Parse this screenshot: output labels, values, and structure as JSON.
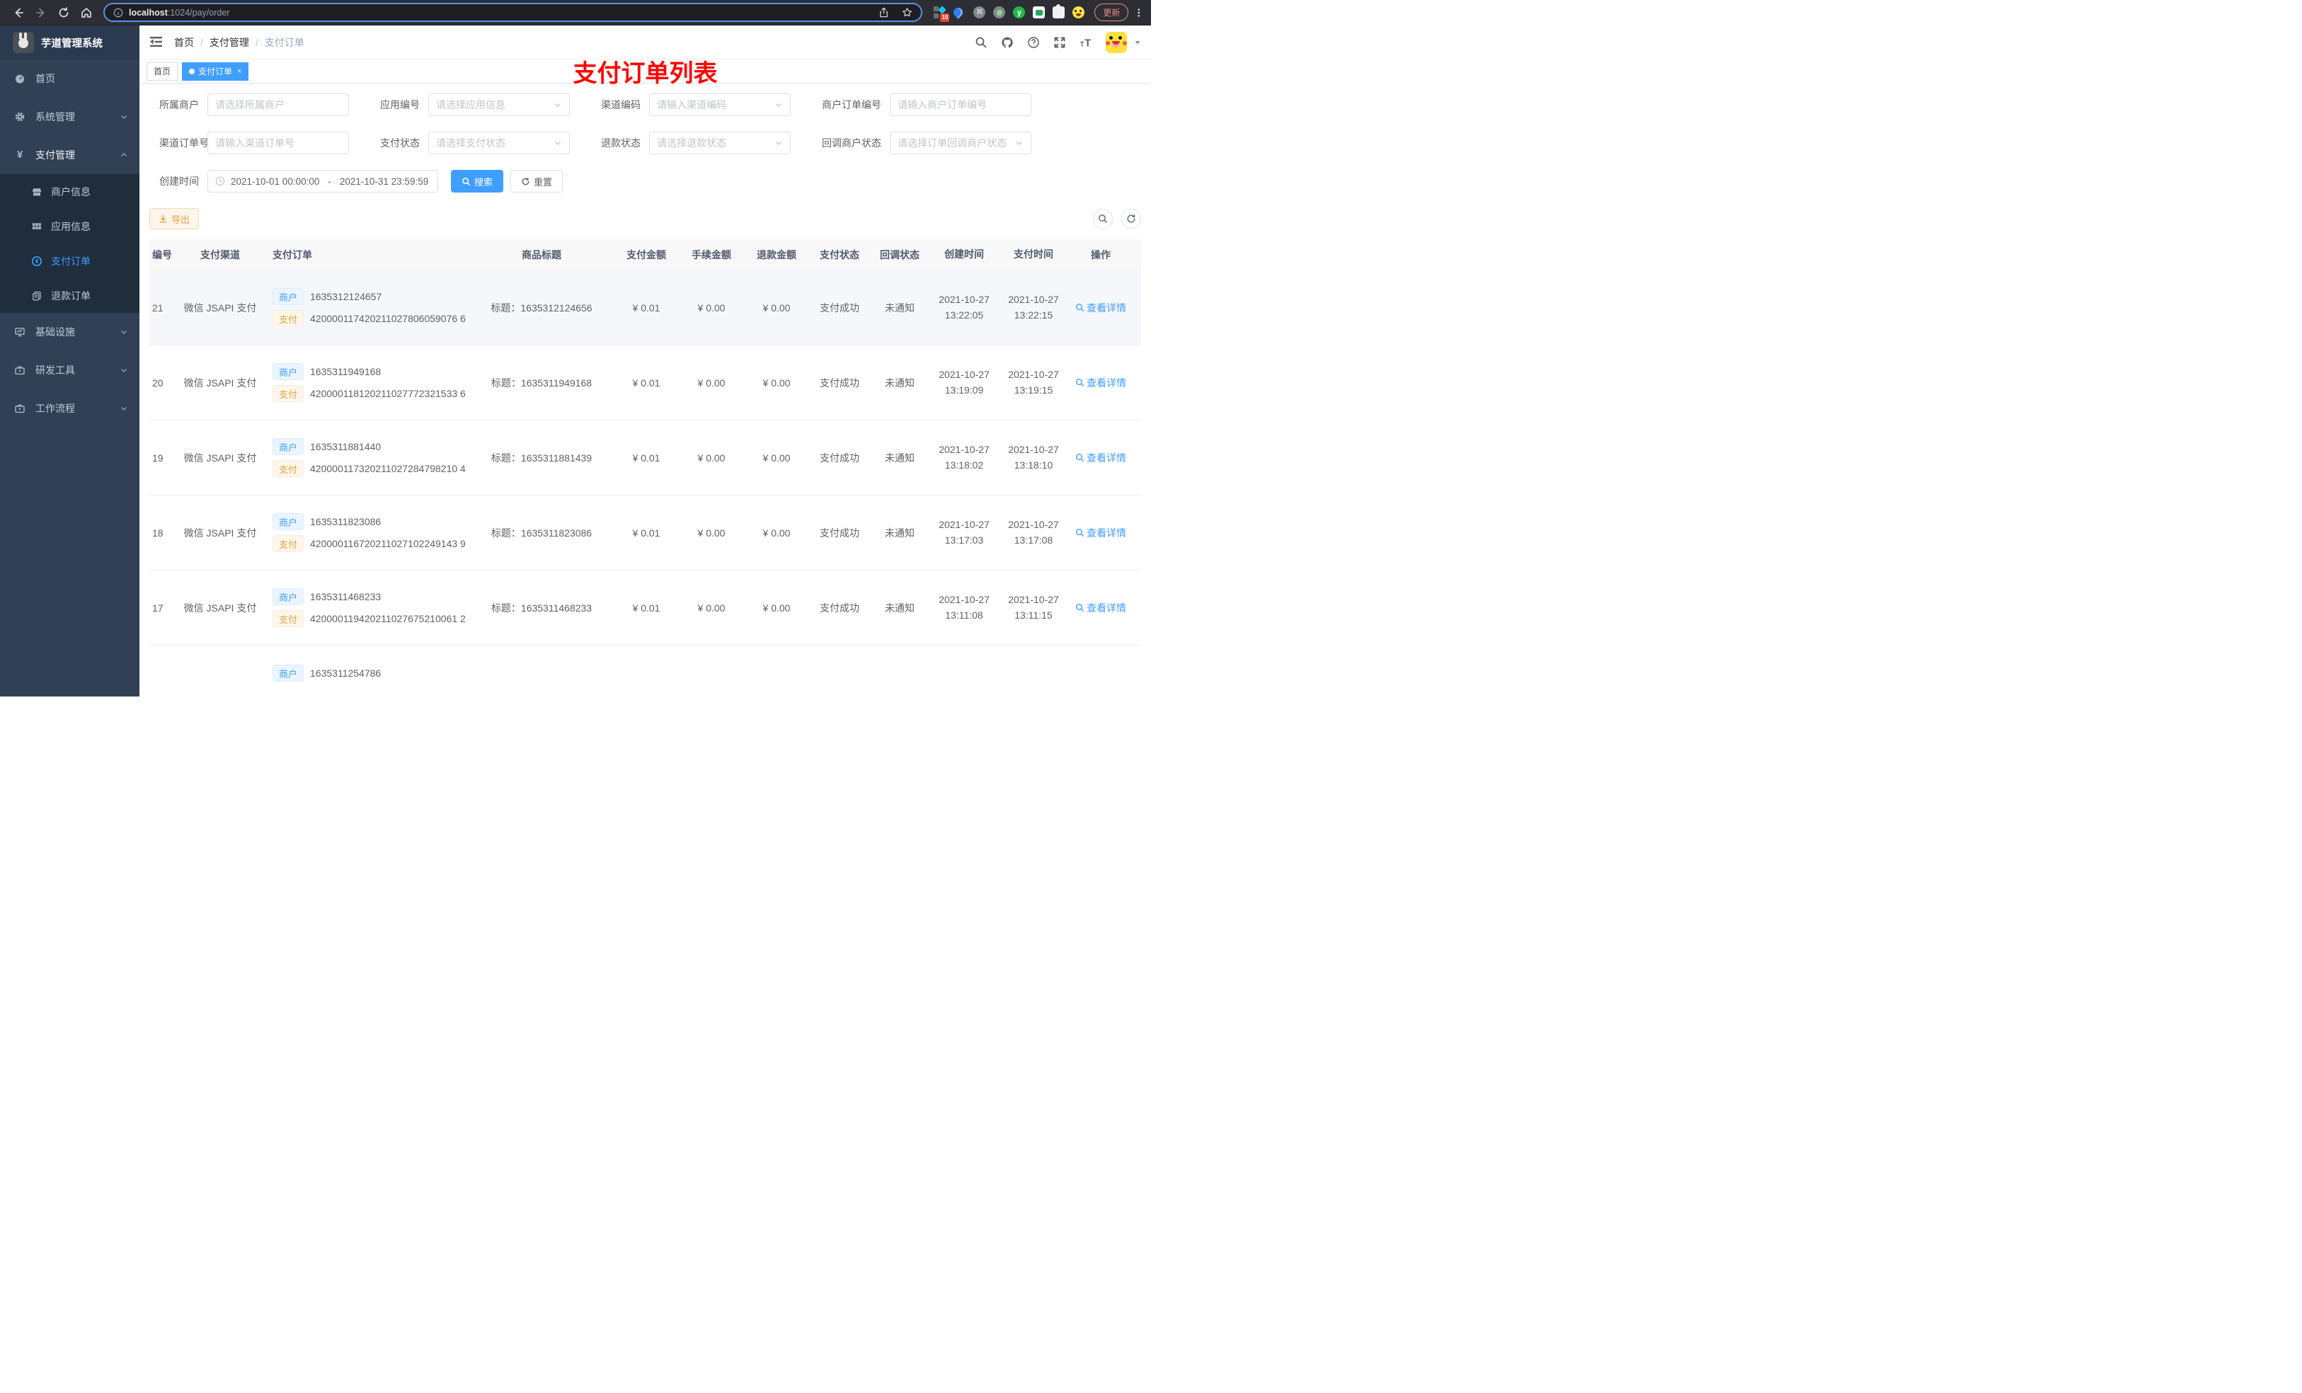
{
  "browser": {
    "url_host": "localhost",
    "url_path": ":1024/pay/order",
    "extension_badge": "10",
    "update_label": "更新"
  },
  "app": {
    "logo_title": "芋道管理系统"
  },
  "sidebar": {
    "items": [
      {
        "label": "首页"
      },
      {
        "label": "系统管理"
      },
      {
        "label": "支付管理"
      },
      {
        "label": "基础设施"
      },
      {
        "label": "研发工具"
      },
      {
        "label": "工作流程"
      }
    ],
    "submenu": [
      {
        "label": "商户信息"
      },
      {
        "label": "应用信息"
      },
      {
        "label": "支付订单"
      },
      {
        "label": "退款订单"
      }
    ]
  },
  "header": {
    "breadcrumb": [
      "首页",
      "支付管理",
      "支付订单"
    ],
    "title": "支付订单列表"
  },
  "tabs": [
    {
      "label": "首页"
    },
    {
      "label": "支付订单"
    }
  ],
  "filters": {
    "merchant": {
      "label": "所属商户",
      "placeholder": "请选择所属商户"
    },
    "app_no": {
      "label": "应用编号",
      "placeholder": "请选择应用信息"
    },
    "channel_code": {
      "label": "渠道编码",
      "placeholder": "请输入渠道编码"
    },
    "merchant_order_no": {
      "label": "商户订单编号",
      "placeholder": "请输入商户订单编号"
    },
    "channel_order_no": {
      "label": "渠道订单号",
      "placeholder": "请输入渠道订单号"
    },
    "pay_status": {
      "label": "支付状态",
      "placeholder": "请选择支付状态"
    },
    "refund_status": {
      "label": "退款状态",
      "placeholder": "请选择退款状态"
    },
    "callback_status": {
      "label": "回调商户状态",
      "placeholder": "请选择订单回调商户状态"
    },
    "create_time": {
      "label": "创建时间",
      "start": "2021-10-01 00:00:00",
      "separator": "-",
      "end": "2021-10-31 23:59:59"
    },
    "search_label": "搜索",
    "reset_label": "重置"
  },
  "toolbar": {
    "export_label": "导出"
  },
  "table": {
    "columns": [
      "编号",
      "支付渠道",
      "支付订单",
      "商品标题",
      "支付金额",
      "手续金额",
      "退款金额",
      "支付状态",
      "回调状态",
      "创建时间",
      "支付时间",
      "操作"
    ],
    "merchant_tag": "商户",
    "pay_tag": "支付",
    "title_prefix": "标题：",
    "action_label": "查看详情",
    "rows": [
      {
        "id": "21",
        "channel": "微信 JSAPI 支付",
        "merchant_no": "1635312124657",
        "pay_no": "420000117420211027806059076 6",
        "title": "1635312124656",
        "amount": "¥ 0.01",
        "fee": "¥ 0.00",
        "refund": "¥ 0.00",
        "status": "支付成功",
        "notify": "未通知",
        "created": "2021-10-27 13:22:05",
        "paid": "2021-10-27 13:22:15"
      },
      {
        "id": "20",
        "channel": "微信 JSAPI 支付",
        "merchant_no": "1635311949168",
        "pay_no": "420000118120211027772321533 6",
        "title": "1635311949168",
        "amount": "¥ 0.01",
        "fee": "¥ 0.00",
        "refund": "¥ 0.00",
        "status": "支付成功",
        "notify": "未通知",
        "created": "2021-10-27 13:19:09",
        "paid": "2021-10-27 13:19:15"
      },
      {
        "id": "19",
        "channel": "微信 JSAPI 支付",
        "merchant_no": "1635311881440",
        "pay_no": "420000117320211027284798210 4",
        "title": "1635311881439",
        "amount": "¥ 0.01",
        "fee": "¥ 0.00",
        "refund": "¥ 0.00",
        "status": "支付成功",
        "notify": "未通知",
        "created": "2021-10-27 13:18:02",
        "paid": "2021-10-27 13:18:10"
      },
      {
        "id": "18",
        "channel": "微信 JSAPI 支付",
        "merchant_no": "1635311823086",
        "pay_no": "420000116720211027102249143 9",
        "title": "1635311823086",
        "amount": "¥ 0.01",
        "fee": "¥ 0.00",
        "refund": "¥ 0.00",
        "status": "支付成功",
        "notify": "未通知",
        "created": "2021-10-27 13:17:03",
        "paid": "2021-10-27 13:17:08"
      },
      {
        "id": "17",
        "channel": "微信 JSAPI 支付",
        "merchant_no": "1635311468233",
        "pay_no": "420000119420211027675210061 2",
        "title": "1635311468233",
        "amount": "¥ 0.01",
        "fee": "¥ 0.00",
        "refund": "¥ 0.00",
        "status": "支付成功",
        "notify": "未通知",
        "created": "2021-10-27 13:11:08",
        "paid": "2021-10-27 13:11:15"
      }
    ],
    "partial_row": {
      "merchant_no": "1635311254786"
    }
  }
}
